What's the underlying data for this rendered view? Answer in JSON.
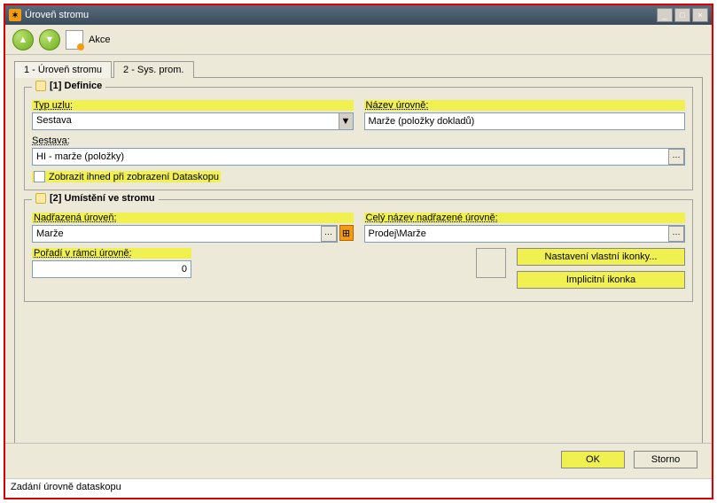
{
  "window": {
    "title": "Úroveň stromu",
    "minimize": "_",
    "maximize": "□",
    "close": "×"
  },
  "toolbar": {
    "up_arrow": "▲",
    "down_arrow": "▼",
    "actions_label": "Akce"
  },
  "tabs": [
    {
      "label": "1 - Úroveň stromu"
    },
    {
      "label": "2 - Sys. prom."
    }
  ],
  "section1": {
    "legend": "[1] Definice",
    "typ_uzlu_label": "Typ uzlu:",
    "typ_uzlu_value": "Sestava",
    "nazev_urovne_label": "Název úrovně:",
    "nazev_urovne_value": "Marže (položky dokladů)",
    "sestava_label": "Sestava:",
    "sestava_value": "HI - marže (položky)",
    "checkbox_label": "Zobrazit ihned při zobrazení Dataskopu"
  },
  "section2": {
    "legend": "[2] Umístění ve stromu",
    "nadrazena_label": "Nadřazená úroveň:",
    "nadrazena_value": "Marže",
    "cely_nazev_label": "Celý název nadřazené úrovně:",
    "cely_nazev_value": "Prodej\\Marže",
    "poradi_label": "Pořadí v rámci úrovně:",
    "poradi_value": "0",
    "nastaveni_btn": "Nastavení vlastní ikonky...",
    "implicit_btn": "Implicitní ikonka"
  },
  "buttons": {
    "ok": "OK",
    "cancel": "Storno"
  },
  "status": "Zadání úrovně dataskopu",
  "glyphs": {
    "dropdown": "▼",
    "ellipsis": "⋯",
    "tree": "⊞"
  }
}
